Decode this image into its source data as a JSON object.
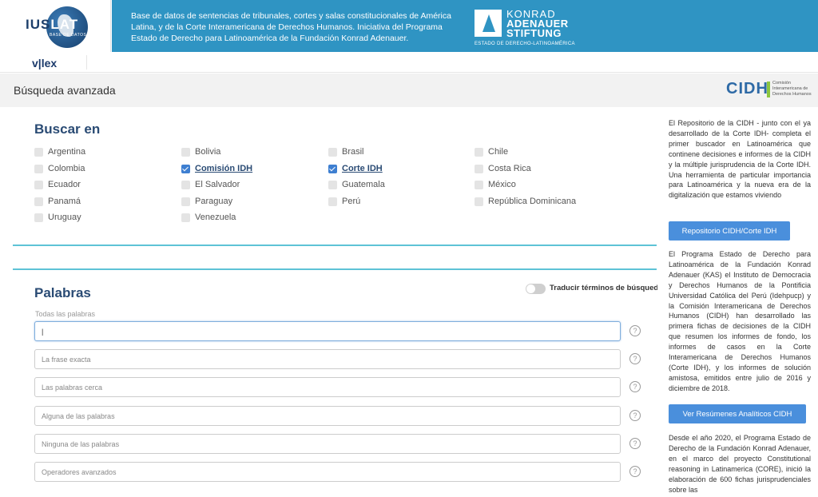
{
  "header": {
    "logo": {
      "word_dark": "IUS",
      "word_light": "LAT",
      "sub": "BASE DE DATOS"
    },
    "banner_text": "Base de datos de sentencias de tribunales, cortes y salas constitucionales de América Latina, y de la Corte Interamericana de Derechos Humanos. Iniciativa del Programa Estado de Derecho para Latinoamérica de la Fundación Konrad Adenauer.",
    "kas": {
      "line1": "KONRAD",
      "line2": "ADENAUER",
      "line3": "STIFTUNG",
      "line4": "ESTADO DE DERECHO-LATINOAMÉRICA"
    },
    "vlex": "v|lex"
  },
  "subheader": {
    "title": "Búsqueda avanzada",
    "cidh_logo": {
      "word": "CIDH",
      "sub": "Comisión Interamericana de Derechos Humanos"
    }
  },
  "buscar": {
    "title": "Buscar en",
    "items": [
      {
        "label": "Argentina",
        "checked": false
      },
      {
        "label": "Bolivia",
        "checked": false
      },
      {
        "label": "Brasil",
        "checked": false
      },
      {
        "label": "Chile",
        "checked": false
      },
      {
        "label": "Colombia",
        "checked": false
      },
      {
        "label": "Comisión IDH",
        "checked": true
      },
      {
        "label": "Corte IDH",
        "checked": true
      },
      {
        "label": "Costa Rica",
        "checked": false
      },
      {
        "label": "Ecuador",
        "checked": false
      },
      {
        "label": "El Salvador",
        "checked": false
      },
      {
        "label": "Guatemala",
        "checked": false
      },
      {
        "label": "México",
        "checked": false
      },
      {
        "label": "Panamá",
        "checked": false
      },
      {
        "label": "Paraguay",
        "checked": false
      },
      {
        "label": "Perú",
        "checked": false
      },
      {
        "label": "República Dominicana",
        "checked": false
      },
      {
        "label": "Uruguay",
        "checked": false
      },
      {
        "label": "Venezuela",
        "checked": false
      }
    ]
  },
  "palabras": {
    "title": "Palabras",
    "toggle_label": "Traducir términos de búsqueda",
    "toggle_on": false,
    "caption": "Todas las palabras",
    "fields": [
      {
        "placeholder": "",
        "value": "|"
      },
      {
        "placeholder": "La frase exacta",
        "value": ""
      },
      {
        "placeholder": "Las palabras cerca",
        "value": ""
      },
      {
        "placeholder": "Alguna de las palabras",
        "value": ""
      },
      {
        "placeholder": "Ninguna de las palabras",
        "value": ""
      },
      {
        "placeholder": "Operadores avanzados",
        "value": ""
      }
    ],
    "help_glyph": "?"
  },
  "sidebar": {
    "p1": "El Repositorio de la CIDH - junto con el ya desarrollado de la Corte IDH- completa el primer buscador en Latinoamérica que continene decisiones e informes de la CIDH y la múltiple jurisprudencia de la Corte IDH. Una herramienta de particular importancia para Latinoamérica y la nueva era de la digitalización que estamos viviendo",
    "btn1": "Repositorio CIDH/Corte IDH",
    "p2": "El Programa Estado de Derecho para Latinoamérica de la Fundación Konrad Adenauer (KAS) el Instituto de Democracia y Derechos Humanos de la Pontificia Universidad Católica del Perú (Idehpucp) y la Comisión Interamericana de Derechos Humanos (CIDH) han desarrollado las primera fichas de decisiones de la CIDH que resumen los informes de fondo, los informes de casos en la Corte Interamericana de Derechos Humanos (Corte IDH), y los informes de solución amistosa, emitidos entre julio de 2016 y diciembre de 2018.",
    "btn2": "Ver Resúmenes Analíticos CIDH",
    "p3": "Desde el año 2020, el Programa Estado de Derecho de la Fundación Konrad Adenauer, en el marco del proyecto Constitutional reasoning in Latinamerica (CORE), inició la elaboración de 600 fichas jurisprudenciales sobre las"
  },
  "colors": {
    "accent": "#2f94c3",
    "title": "#2a4b74",
    "rule": "#5ec3d6",
    "button": "#4a8fdc",
    "checked": "#3e7fd1"
  }
}
